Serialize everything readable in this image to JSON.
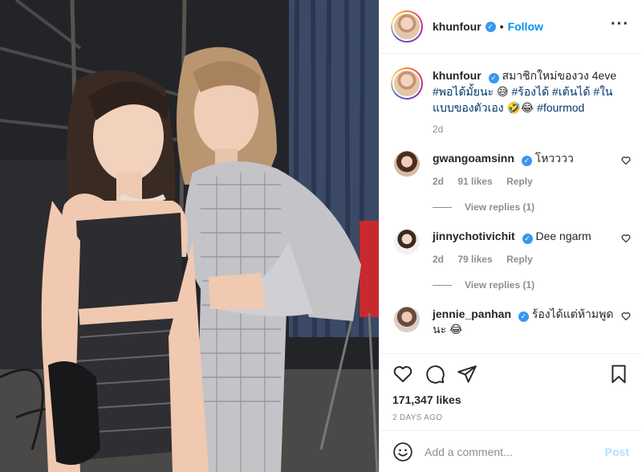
{
  "post": {
    "username": "khunfour",
    "follow_label": "Follow",
    "more_icon": "more-horizontal-icon",
    "caption": {
      "username": "khunfour",
      "text_1": "สมาชิกใหม่ของวง 4eve",
      "tag_1": "#พอได้มั้ยนะ",
      "emoji_1": "😅",
      "tag_2": "#ร้องได้",
      "tag_3": "#เต้นได้",
      "tag_4": "#ในแบบของตัวเอง",
      "emoji_2": "🤣😂",
      "tag_5": "#fourmod",
      "time": "2d"
    },
    "comments": [
      {
        "username": "gwangoamsinn",
        "text": "โหวววว",
        "time": "2d",
        "likes": "91 likes",
        "reply": "Reply",
        "view_replies": "View replies (1)"
      },
      {
        "username": "jinnychotivichit",
        "text": "Dee ngarm",
        "time": "2d",
        "likes": "79 likes",
        "reply": "Reply",
        "view_replies": "View replies (1)"
      },
      {
        "username": "jennie_panhan",
        "text": "ร้องได้แต่ห้ามพูดนะ 😂"
      }
    ],
    "likes": "171,347 likes",
    "date": "2 DAYS AGO",
    "add_comment": {
      "placeholder": "Add a comment...",
      "post_label": "Post"
    }
  },
  "colors": {
    "link": "#0095f6",
    "hashtag": "#00376b",
    "verified": "#3897f0",
    "muted": "#8e8e8e",
    "post_disabled": "#b2dffc"
  }
}
